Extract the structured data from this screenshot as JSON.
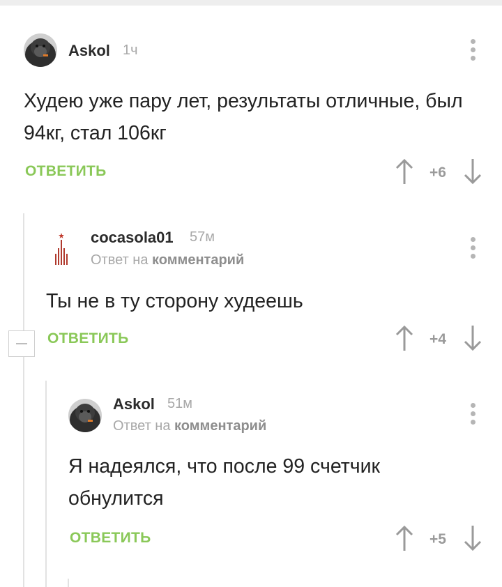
{
  "comments": [
    {
      "author": "Askol",
      "time": "1ч",
      "text": "Худею уже пару лет, результаты отличные, был 94кг, стал 106кг",
      "reply_label": "ОТВЕТИТЬ",
      "score": "+6",
      "avatar_icon": "gorilla-avatar"
    },
    {
      "author": "cocasola01",
      "time": "57м",
      "reply_prefix": "Ответ на",
      "reply_target": "комментарий",
      "text": "Ты не в ту сторону худеешь",
      "reply_label": "ОТВЕТИТЬ",
      "score": "+4",
      "avatar_icon": "tower-logo-avatar"
    },
    {
      "author": "Askol",
      "time": "51м",
      "reply_prefix": "Ответ на",
      "reply_target": "комментарий",
      "text": "Я надеялся, что после 99 счетчик обнулится",
      "reply_label": "ОТВЕТИТЬ",
      "score": "+5",
      "avatar_icon": "gorilla-avatar"
    }
  ],
  "colors": {
    "accent": "#8ac858",
    "muted": "#a8a8a8",
    "thread_line": "#e2e2e2"
  },
  "icons": [
    "more-vertical-icon",
    "arrow-up-icon",
    "arrow-down-icon",
    "collapse-minus-icon"
  ]
}
